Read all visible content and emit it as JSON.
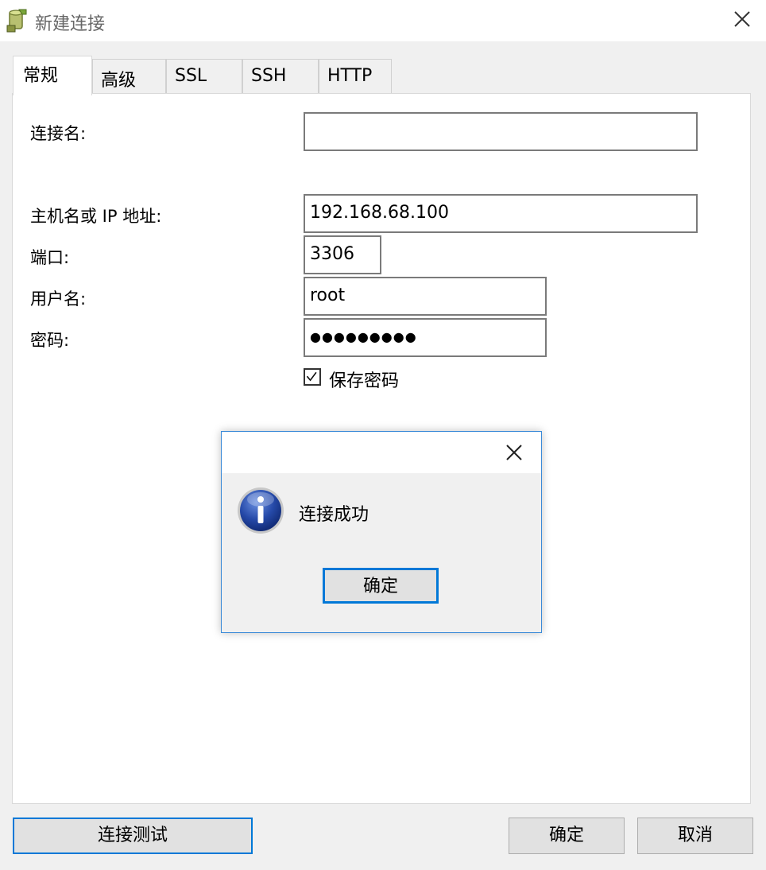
{
  "window": {
    "title": "新建连接",
    "icon": "database-connection-icon",
    "close_icon": "close-icon"
  },
  "tabs": [
    {
      "label": "常规",
      "active": true
    },
    {
      "label": "高级",
      "active": false
    },
    {
      "label": "SSL",
      "active": false
    },
    {
      "label": "SSH",
      "active": false
    },
    {
      "label": "HTTP",
      "active": false
    }
  ],
  "form": {
    "connection_name": {
      "label": "连接名:",
      "value": ""
    },
    "host": {
      "label": "主机名或 IP 地址:",
      "value": "192.168.68.100"
    },
    "port": {
      "label": "端口:",
      "value": "3306"
    },
    "username": {
      "label": "用户名:",
      "value": "root"
    },
    "password": {
      "label": "密码:",
      "value": "●●●●●●●●●"
    },
    "save_password": {
      "label": "保存密码",
      "checked": true
    }
  },
  "buttons": {
    "test": "连接测试",
    "ok": "确定",
    "cancel": "取消"
  },
  "dialog": {
    "message": "连接成功",
    "ok": "确定",
    "icon": "info-icon",
    "close_icon": "close-icon"
  },
  "colors": {
    "accent": "#0078d7",
    "info_blue": "#1f4fa8"
  }
}
